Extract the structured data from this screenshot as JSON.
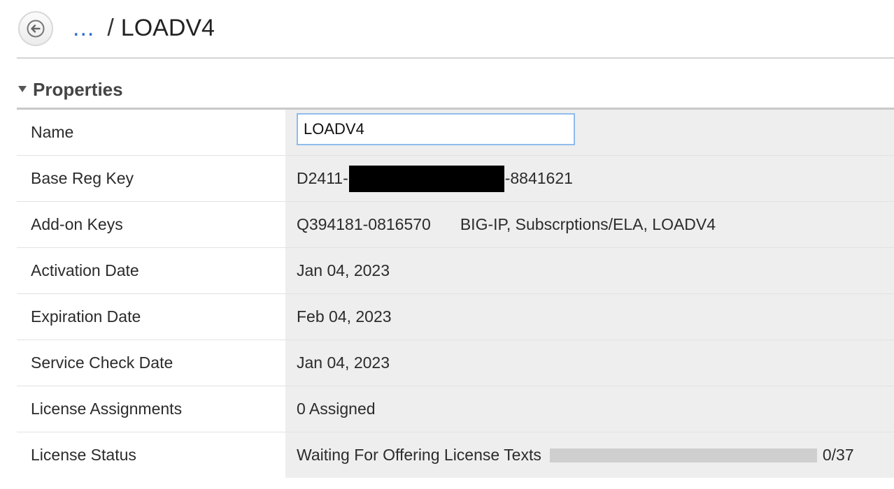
{
  "header": {
    "breadcrumb_ellipsis": "...",
    "breadcrumb_separator": "/",
    "breadcrumb_current": "LOADV4"
  },
  "section": {
    "title": "Properties",
    "expanded": true
  },
  "properties": {
    "name": {
      "label": "Name",
      "value": "LOADV4"
    },
    "base_reg_key": {
      "label": "Base Reg Key",
      "prefix": "D2411-",
      "suffix": "-8841621"
    },
    "addon_keys": {
      "label": "Add-on Keys",
      "key": "Q394181-0816570",
      "description": "BIG-IP, Subscrptions/ELA, LOADV4"
    },
    "activation_date": {
      "label": "Activation Date",
      "value": "Jan 04, 2023"
    },
    "expiration_date": {
      "label": "Expiration Date",
      "value": "Feb 04, 2023"
    },
    "service_check_date": {
      "label": "Service Check Date",
      "value": "Jan 04, 2023"
    },
    "license_assignments": {
      "label": "License Assignments",
      "value": "0 Assigned"
    },
    "license_status": {
      "label": "License Status",
      "value": "Waiting For Offering License Texts",
      "progress_text": "0/37",
      "progress_fraction": 0
    }
  },
  "colors": {
    "link": "#2c6fc7",
    "input_border": "#8fbcec",
    "value_bg": "#eeeeee",
    "progress_track": "#cfcfcf"
  }
}
